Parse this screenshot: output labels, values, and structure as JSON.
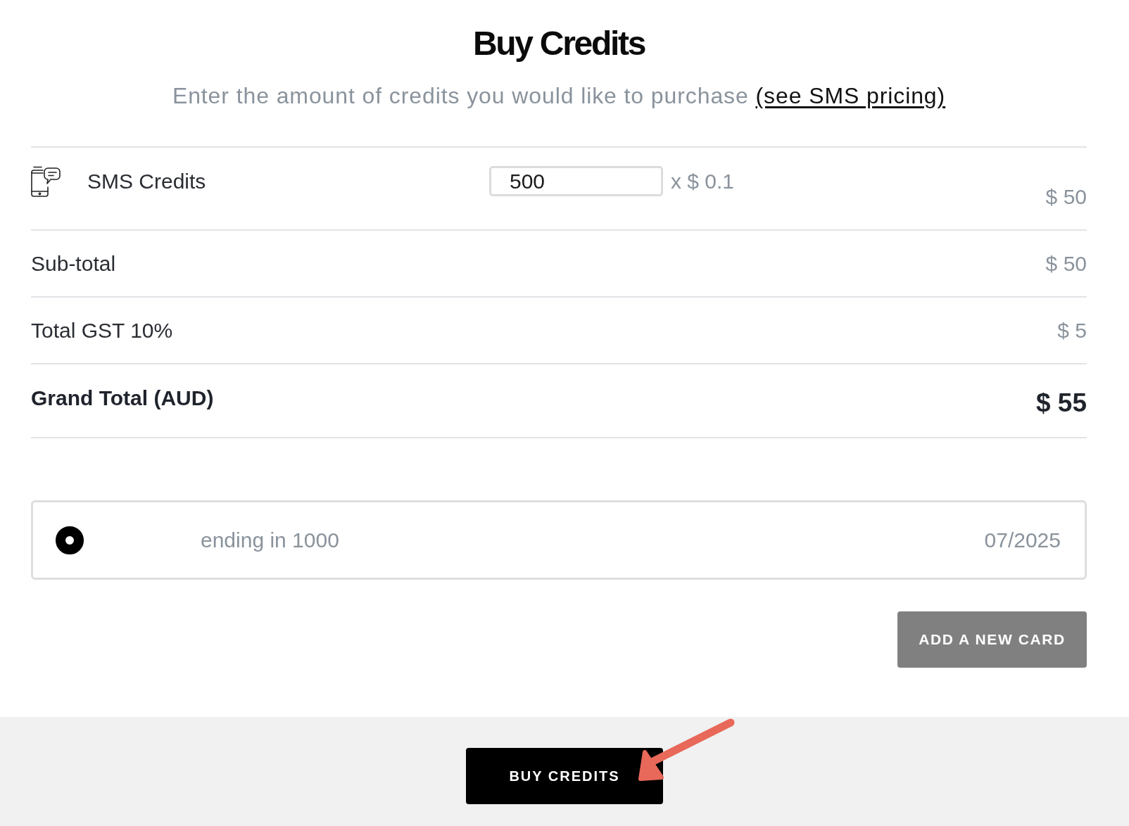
{
  "header": {
    "title": "Buy Credits",
    "subtitle": "Enter the amount of credits you would like to purchase",
    "pricing_link": "(see SMS pricing)"
  },
  "items": [
    {
      "name": "SMS Credits",
      "quantity": "500",
      "unit_price": "x $ 0.1",
      "amount": "$ 50"
    }
  ],
  "summary": [
    {
      "kind": "normal",
      "label": "Sub-total",
      "value": "$ 50"
    },
    {
      "kind": "normal",
      "label": "Total GST 10%",
      "value": "$ 5"
    },
    {
      "kind": "grand",
      "label": "Grand Total (AUD)",
      "value": "$ 55"
    }
  ],
  "cards": [
    {
      "number": "ending in 1000",
      "expiry": "07/2025",
      "selected": true
    }
  ],
  "add_card_button": "ADD A NEW CARD",
  "buy_button": "BUY CREDITS"
}
